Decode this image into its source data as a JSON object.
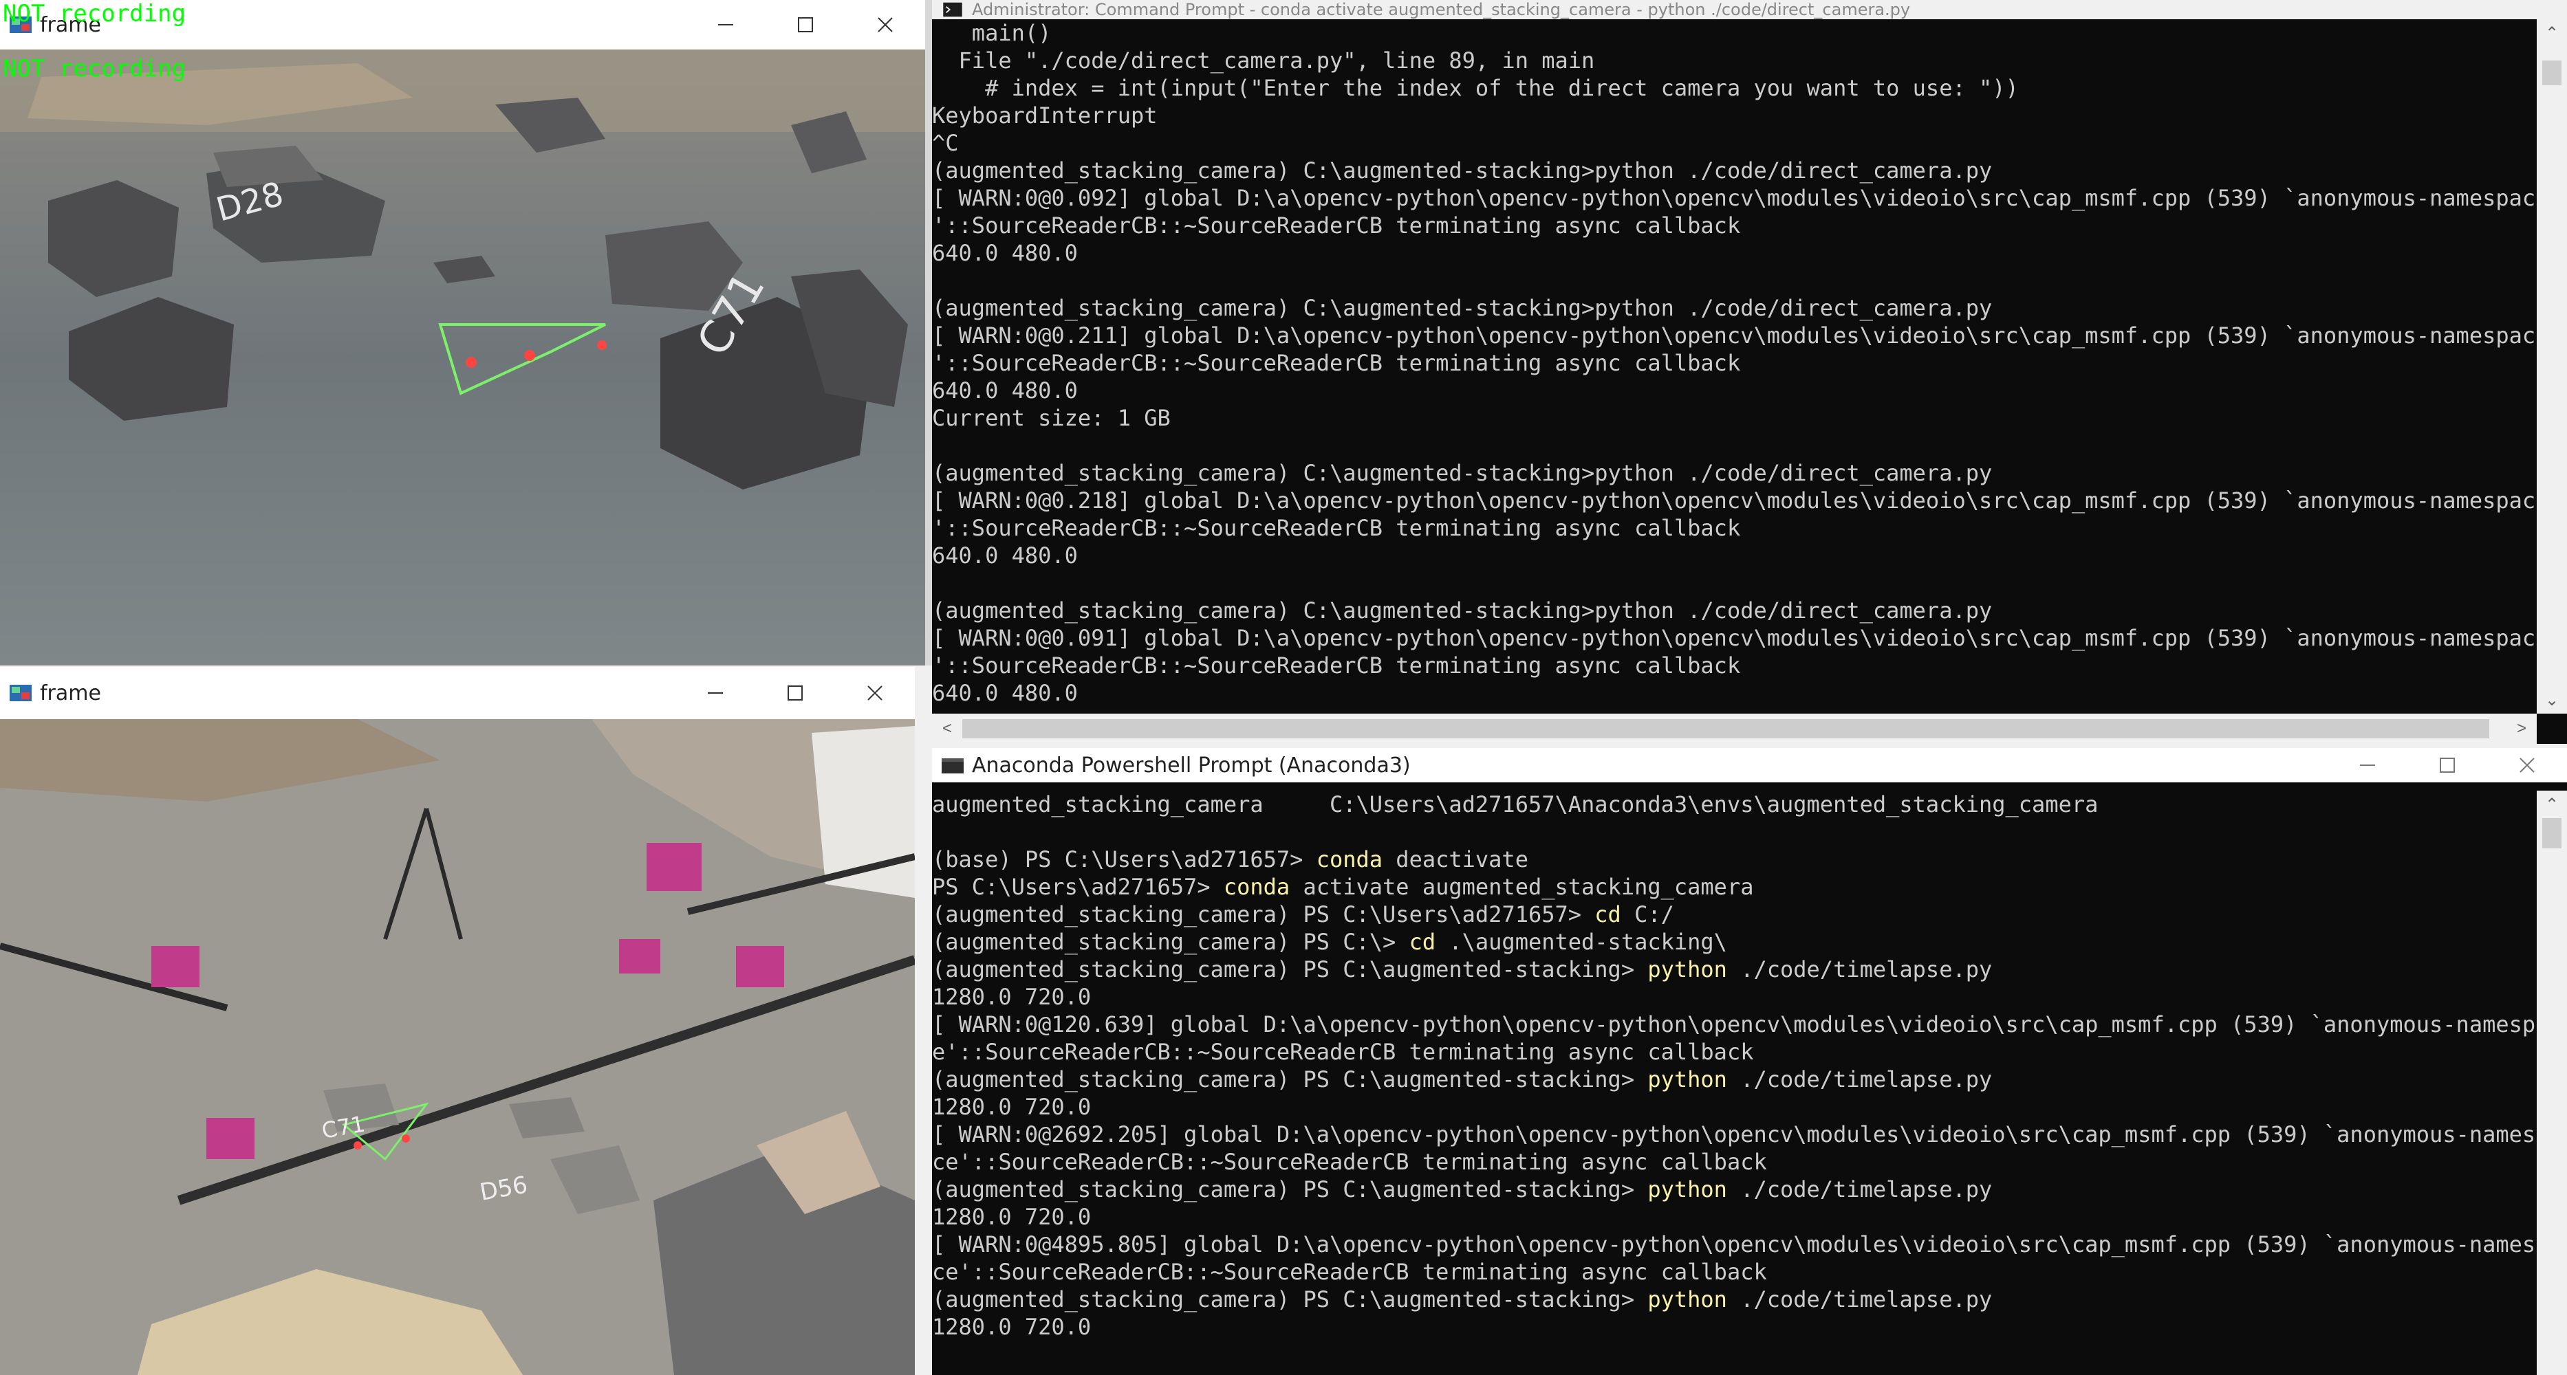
{
  "frame_top": {
    "title": "frame",
    "overlay": "NOT recording"
  },
  "frame_bottom": {
    "title": "frame",
    "overlay": "NOT recording"
  },
  "cmd_window": {
    "title": "Administrator: Command Prompt - conda activate augmented_stacking_camera - python ./code/direct_camera.py",
    "lines": [
      "   main()",
      "  File \"./code/direct_camera.py\", line 89, in main",
      "    # index = int(input(\"Enter the index of the direct camera you want to use: \"))",
      "KeyboardInterrupt",
      "^C",
      "(augmented_stacking_camera) C:\\augmented-stacking>python ./code/direct_camera.py",
      "[ WARN:0@0.092] global D:\\a\\opencv-python\\opencv-python\\opencv\\modules\\videoio\\src\\cap_msmf.cpp (539) `anonymous-namespac",
      "'::SourceReaderCB::~SourceReaderCB terminating async callback",
      "640.0 480.0",
      "",
      "(augmented_stacking_camera) C:\\augmented-stacking>python ./code/direct_camera.py",
      "[ WARN:0@0.211] global D:\\a\\opencv-python\\opencv-python\\opencv\\modules\\videoio\\src\\cap_msmf.cpp (539) `anonymous-namespac",
      "'::SourceReaderCB::~SourceReaderCB terminating async callback",
      "640.0 480.0",
      "Current size: 1 GB",
      "",
      "(augmented_stacking_camera) C:\\augmented-stacking>python ./code/direct_camera.py",
      "[ WARN:0@0.218] global D:\\a\\opencv-python\\opencv-python\\opencv\\modules\\videoio\\src\\cap_msmf.cpp (539) `anonymous-namespac",
      "'::SourceReaderCB::~SourceReaderCB terminating async callback",
      "640.0 480.0",
      "",
      "(augmented_stacking_camera) C:\\augmented-stacking>python ./code/direct_camera.py",
      "[ WARN:0@0.091] global D:\\a\\opencv-python\\opencv-python\\opencv\\modules\\videoio\\src\\cap_msmf.cpp (539) `anonymous-namespac",
      "'::SourceReaderCB::~SourceReaderCB terminating async callback",
      "640.0 480.0"
    ]
  },
  "ps_window": {
    "title": "Anaconda Powershell Prompt (Anaconda3)",
    "lines": [
      {
        "pre": "augmented_stacking_camera     C:\\Users\\ad271657\\Anaconda3\\envs\\augmented_stacking_camera",
        "kw": "",
        "post": ""
      },
      {
        "pre": "",
        "kw": "",
        "post": ""
      },
      {
        "pre": "(base) PS C:\\Users\\ad271657> ",
        "kw": "conda",
        "post": " deactivate"
      },
      {
        "pre": "PS C:\\Users\\ad271657> ",
        "kw": "conda",
        "post": " activate augmented_stacking_camera"
      },
      {
        "pre": "(augmented_stacking_camera) PS C:\\Users\\ad271657> ",
        "kw": "cd",
        "post": " C:/"
      },
      {
        "pre": "(augmented_stacking_camera) PS C:\\> ",
        "kw": "cd",
        "post": " .\\augmented-stacking\\"
      },
      {
        "pre": "(augmented_stacking_camera) PS C:\\augmented-stacking> ",
        "kw": "python",
        "post": " ./code/timelapse.py"
      },
      {
        "pre": "1280.0 720.0",
        "kw": "",
        "post": ""
      },
      {
        "pre": "[ WARN:0@120.639] global D:\\a\\opencv-python\\opencv-python\\opencv\\modules\\videoio\\src\\cap_msmf.cpp (539) `anonymous-namespac",
        "kw": "",
        "post": ""
      },
      {
        "pre": "e'::SourceReaderCB::~SourceReaderCB terminating async callback",
        "kw": "",
        "post": ""
      },
      {
        "pre": "(augmented_stacking_camera) PS C:\\augmented-stacking> ",
        "kw": "python",
        "post": " ./code/timelapse.py"
      },
      {
        "pre": "1280.0 720.0",
        "kw": "",
        "post": ""
      },
      {
        "pre": "[ WARN:0@2692.205] global D:\\a\\opencv-python\\opencv-python\\opencv\\modules\\videoio\\src\\cap_msmf.cpp (539) `anonymous-namespa",
        "kw": "",
        "post": ""
      },
      {
        "pre": "ce'::SourceReaderCB::~SourceReaderCB terminating async callback",
        "kw": "",
        "post": ""
      },
      {
        "pre": "(augmented_stacking_camera) PS C:\\augmented-stacking> ",
        "kw": "python",
        "post": " ./code/timelapse.py"
      },
      {
        "pre": "1280.0 720.0",
        "kw": "",
        "post": ""
      },
      {
        "pre": "[ WARN:0@4895.805] global D:\\a\\opencv-python\\opencv-python\\opencv\\modules\\videoio\\src\\cap_msmf.cpp (539) `anonymous-namespa",
        "kw": "",
        "post": ""
      },
      {
        "pre": "ce'::SourceReaderCB::~SourceReaderCB terminating async callback",
        "kw": "",
        "post": ""
      },
      {
        "pre": "(augmented_stacking_camera) PS C:\\augmented-stacking> ",
        "kw": "python",
        "post": " ./code/timelapse.py"
      },
      {
        "pre": "1280.0 720.0",
        "kw": "",
        "post": ""
      }
    ]
  },
  "colors": {
    "terminal_bg": "#0c0c0c",
    "terminal_fg": "#cccccc",
    "ps_keyword": "#f9f1a5",
    "overlay_green": "#00ff00"
  },
  "icons": {
    "window_controls": [
      "minimize-icon",
      "maximize-icon",
      "close-icon"
    ],
    "frame_app": "opencv-frame-icon",
    "terminal_app": "terminal-icon"
  }
}
